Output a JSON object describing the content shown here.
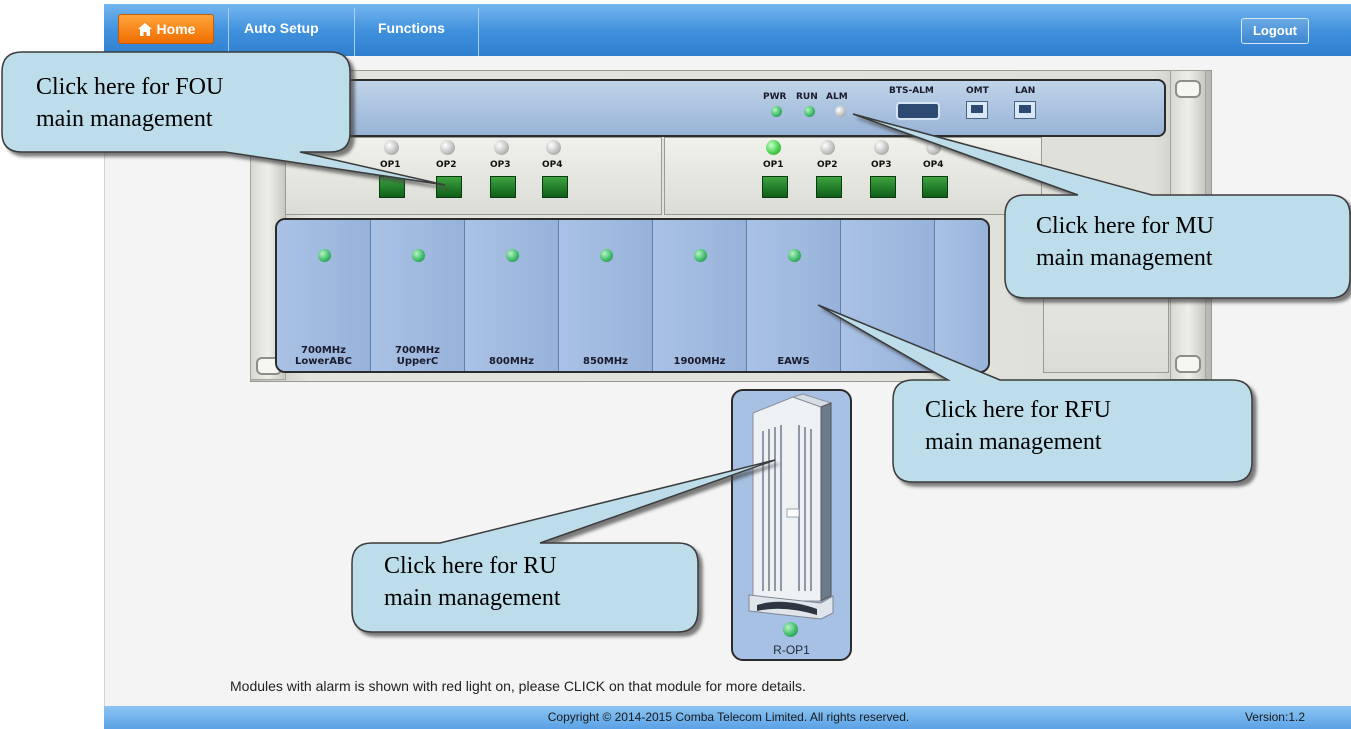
{
  "nav": {
    "tabs": [
      {
        "label": "Home",
        "active": true
      },
      {
        "label": "Auto Setup"
      },
      {
        "label": "Functions"
      }
    ],
    "logout_label": "Logout",
    "colors": {
      "bar": "#3e8fdc",
      "home_tab": "#f06d00"
    }
  },
  "mu": {
    "indicators": [
      "PWR",
      "RUN",
      "ALM"
    ],
    "indicator_state": [
      "green",
      "green",
      "off"
    ],
    "ports": [
      "BTS-ALM",
      "OMT",
      "LAN"
    ]
  },
  "fou_left": {
    "ports": [
      "OP1",
      "OP2",
      "OP3",
      "OP4"
    ],
    "led_state": [
      "off",
      "off",
      "off",
      "off"
    ]
  },
  "fou_right": {
    "ports": [
      "OP1",
      "OP2",
      "OP3",
      "OP4"
    ],
    "led_state": [
      "green",
      "off",
      "off",
      "off"
    ]
  },
  "rfu": {
    "slots": [
      {
        "label_1": "700MHz",
        "label_2": "LowerABC",
        "led": "green"
      },
      {
        "label_1": "700MHz",
        "label_2": "UpperC",
        "led": "green"
      },
      {
        "label_1": "800MHz",
        "label_2": "",
        "led": "green"
      },
      {
        "label_1": "850MHz",
        "label_2": "",
        "led": "green"
      },
      {
        "label_1": "1900MHz",
        "label_2": "",
        "led": "green"
      },
      {
        "label_1": "EAWS",
        "label_2": "",
        "led": "green"
      },
      {
        "label_1": "",
        "label_2": "",
        "led": "none"
      }
    ]
  },
  "ru": {
    "label": "R-OP1",
    "led": "green"
  },
  "callouts": {
    "fou": {
      "line1": "Click here for FOU",
      "line2": "main management"
    },
    "mu": {
      "line1": "Click here for MU",
      "line2": "main management"
    },
    "rfu": {
      "line1": "Click here for RFU",
      "line2": "main management"
    },
    "ru": {
      "line1": "Click here for RU",
      "line2": "main management"
    }
  },
  "note": "Modules with alarm is shown with red light on, please CLICK on that module for more details.",
  "footer": {
    "copyright": "Copyright © 2014-2015 Comba Telecom Limited. All rights reserved.",
    "version": "Version:1.2"
  }
}
